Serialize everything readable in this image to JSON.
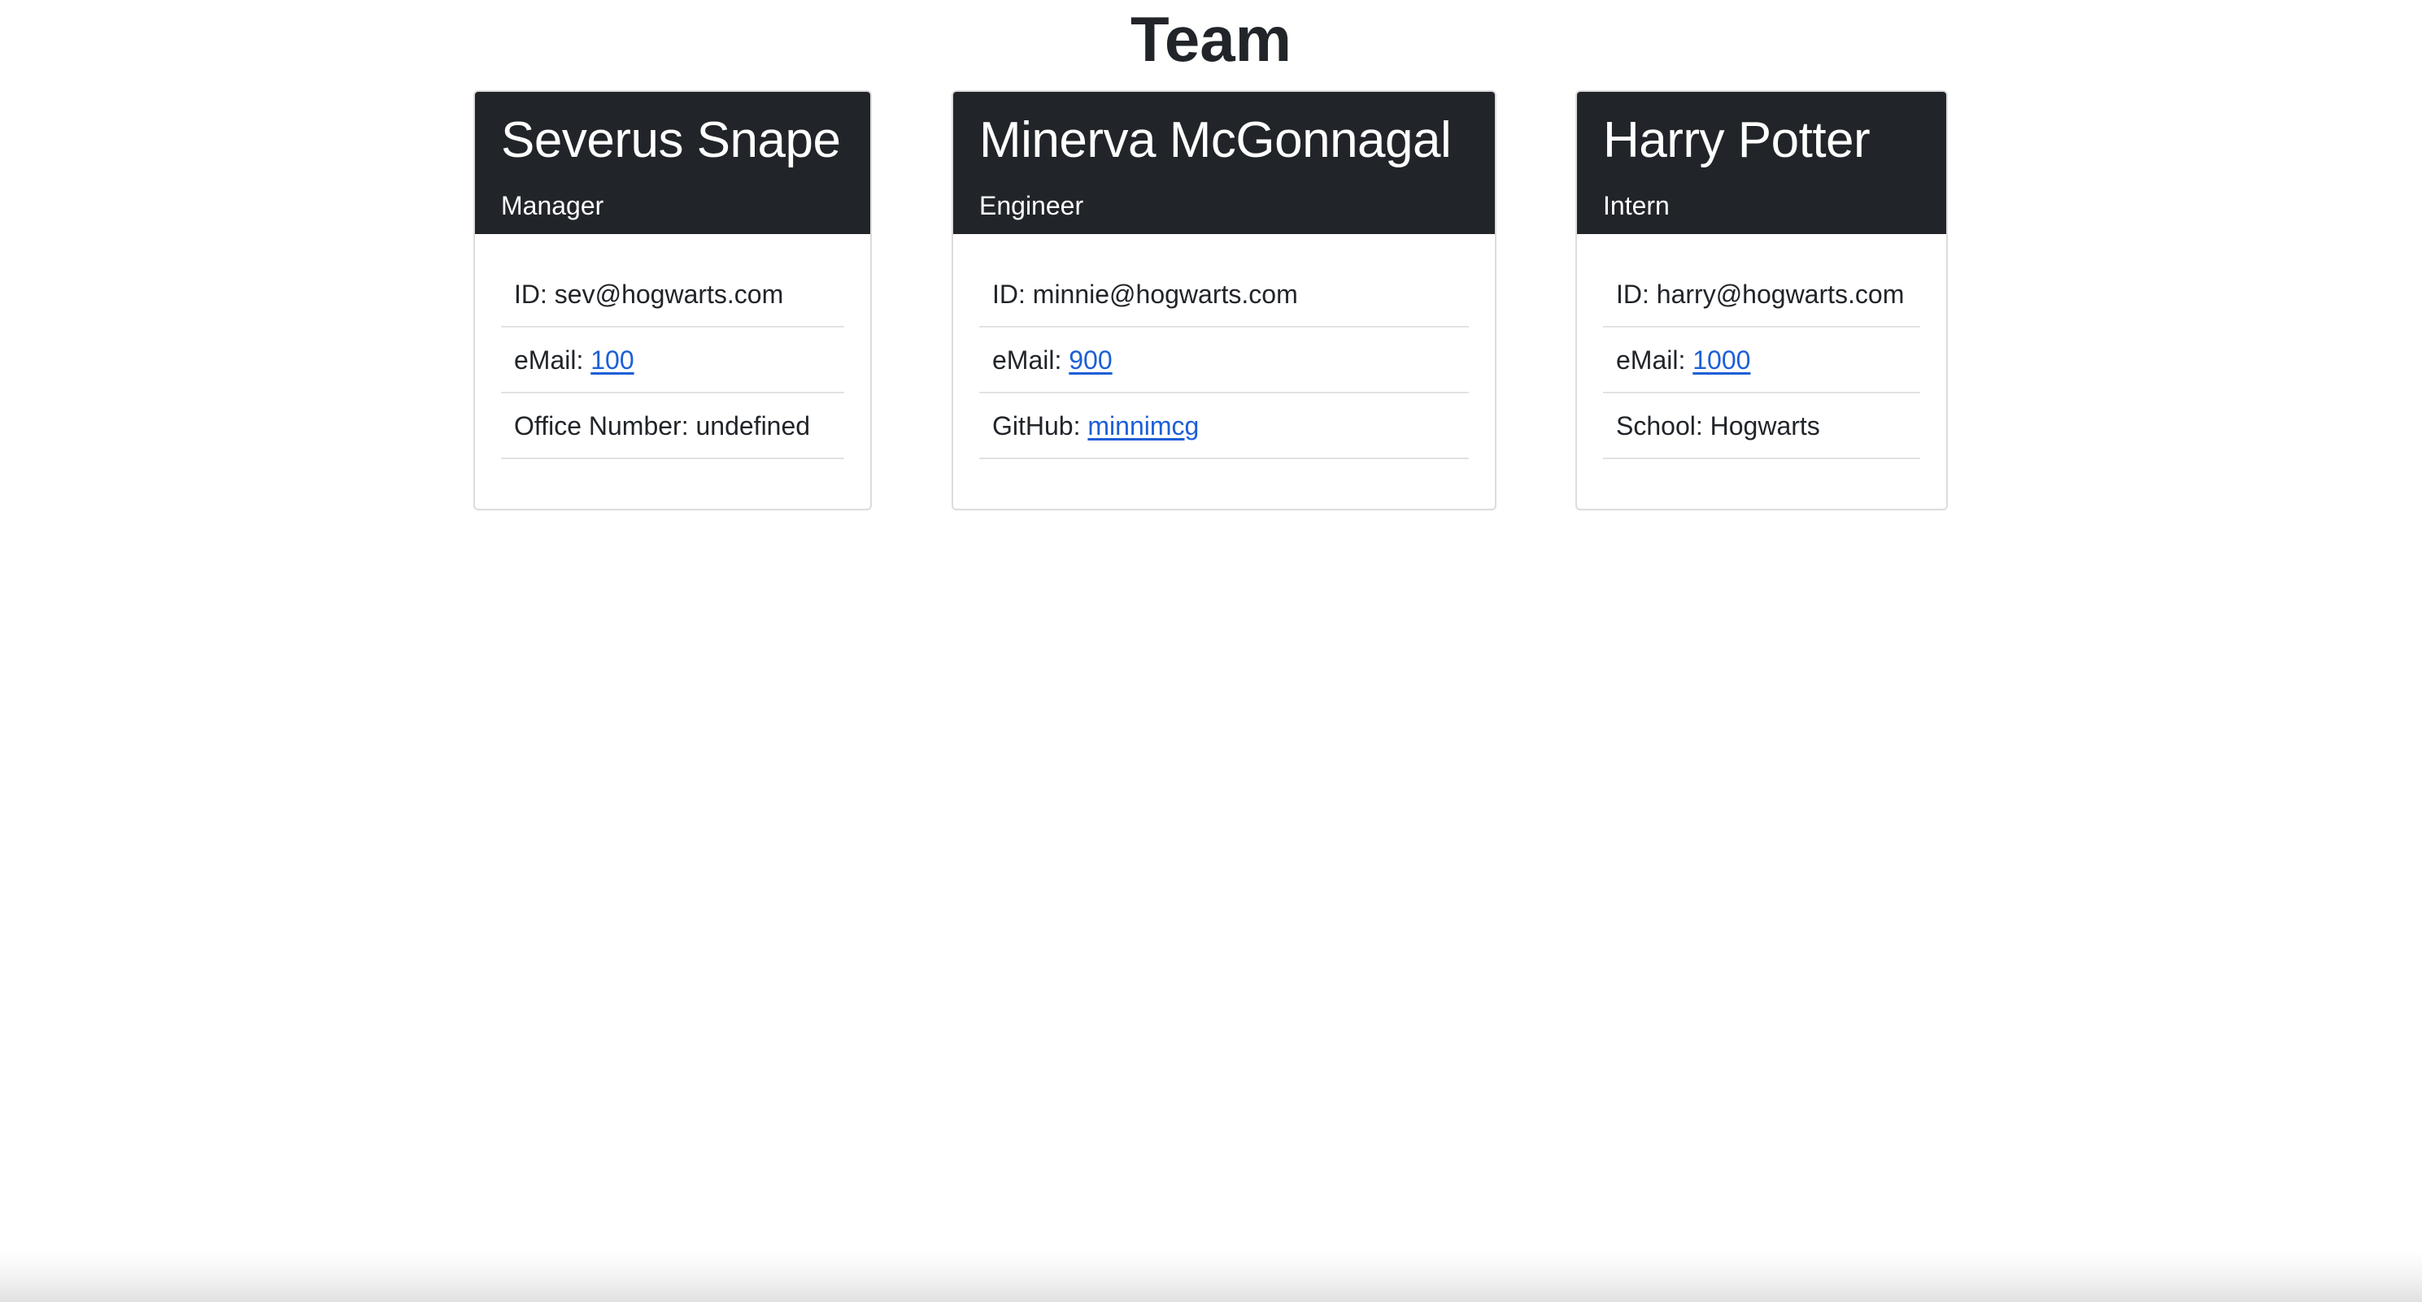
{
  "page": {
    "title": "Team"
  },
  "team": [
    {
      "name": "Severus Snape",
      "role": "Manager",
      "id_label": "ID: ",
      "id_value": "sev@hogwarts.com",
      "email_label": "eMail: ",
      "email_value": "100",
      "extra_label": "Office Number: ",
      "extra_value": "undefined"
    },
    {
      "name": "Minerva McGonnagal",
      "role": "Engineer",
      "id_label": "ID: ",
      "id_value": "minnie@hogwarts.com",
      "email_label": "eMail: ",
      "email_value": "900",
      "extra_label": "GitHub: ",
      "extra_value": "minnimcg"
    },
    {
      "name": "Harry Potter",
      "role": "Intern",
      "id_label": "ID: ",
      "id_value": "harry@hogwarts.com",
      "email_label": "eMail: ",
      "email_value": "1000",
      "extra_label": "School: ",
      "extra_value": "Hogwarts"
    }
  ],
  "colors": {
    "card_header_bg": "#212529",
    "link": "#1d5fd6",
    "text": "#212529"
  }
}
